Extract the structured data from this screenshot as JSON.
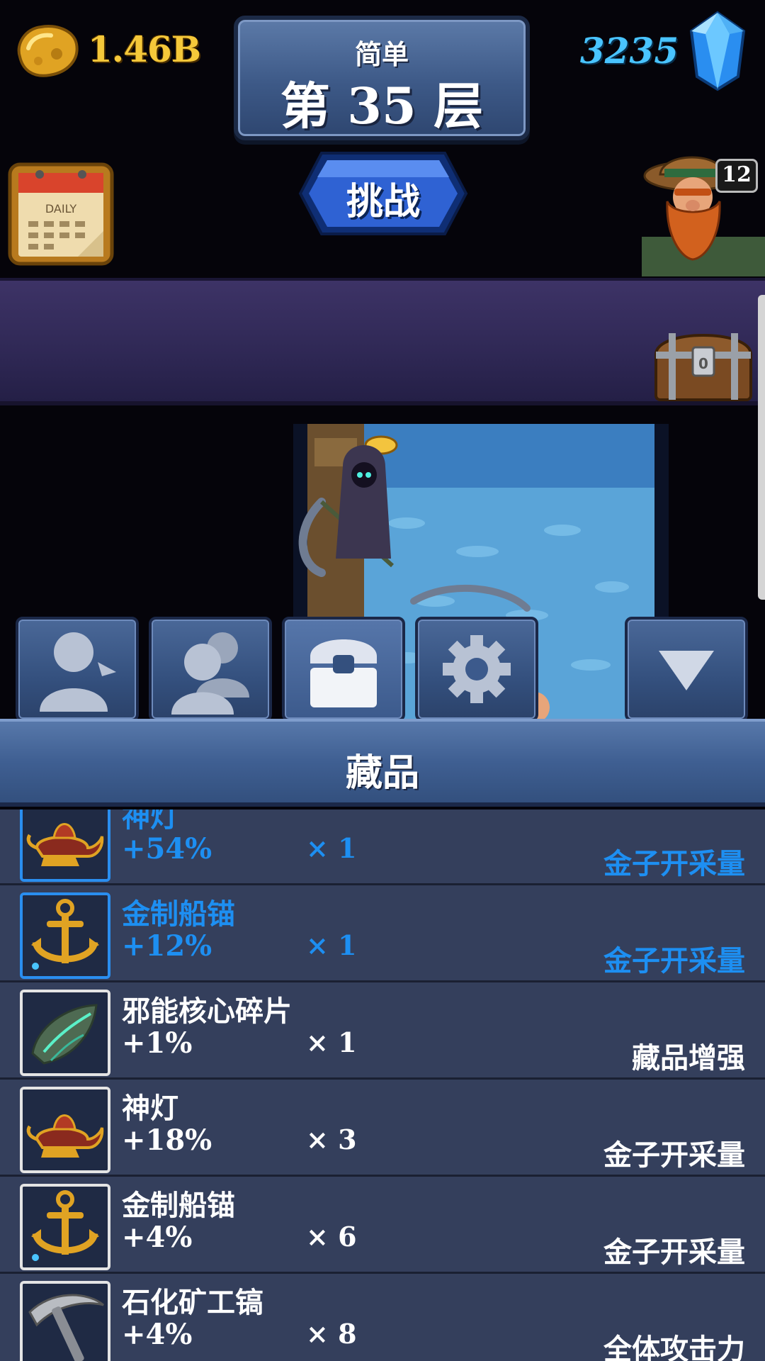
{
  "hud": {
    "gold": "1.46B",
    "gems": "3235",
    "difficulty": "简单",
    "floor_title": "第 35 层",
    "challenge_label": "挑战",
    "hero_level": "12",
    "calendar_label": "DAILY",
    "chest_counter": "0"
  },
  "tabs": [
    {
      "icon": "person-icon",
      "selected": false
    },
    {
      "icon": "group-icon",
      "selected": false
    },
    {
      "icon": "chest-icon",
      "selected": true
    },
    {
      "icon": "gear-icon",
      "selected": false
    },
    {
      "icon": "triangle-down-icon",
      "selected": false
    }
  ],
  "section_title": "藏品",
  "relics": [
    {
      "icon": "genie-lamp-icon",
      "name": "神灯",
      "bonus": "+54%",
      "qty": "× 1",
      "type": "金子开采量",
      "highlight": true
    },
    {
      "icon": "golden-anchor-icon",
      "name": "金制船锚",
      "bonus": "+12%",
      "qty": "× 1",
      "type": "金子开采量",
      "highlight": true
    },
    {
      "icon": "fel-core-shard-icon",
      "name": "邪能核心碎片",
      "bonus": "+1%",
      "qty": "× 1",
      "type": "藏品增强",
      "highlight": false
    },
    {
      "icon": "genie-lamp-icon",
      "name": "神灯",
      "bonus": "+18%",
      "qty": "× 3",
      "type": "金子开采量",
      "highlight": false
    },
    {
      "icon": "golden-anchor-icon",
      "name": "金制船锚",
      "bonus": "+4%",
      "qty": "× 6",
      "type": "金子开采量",
      "highlight": false
    },
    {
      "icon": "petrified-pickaxe-icon",
      "name": "石化矿工镐",
      "bonus": "+4%",
      "qty": "× 8",
      "type": "全体攻击力",
      "highlight": false
    }
  ],
  "colors": {
    "gold_text": "#f5c83a",
    "gem_text": "#49c4ff",
    "highlight_text": "#1d8ff2",
    "row_bg": "#343f5c"
  }
}
